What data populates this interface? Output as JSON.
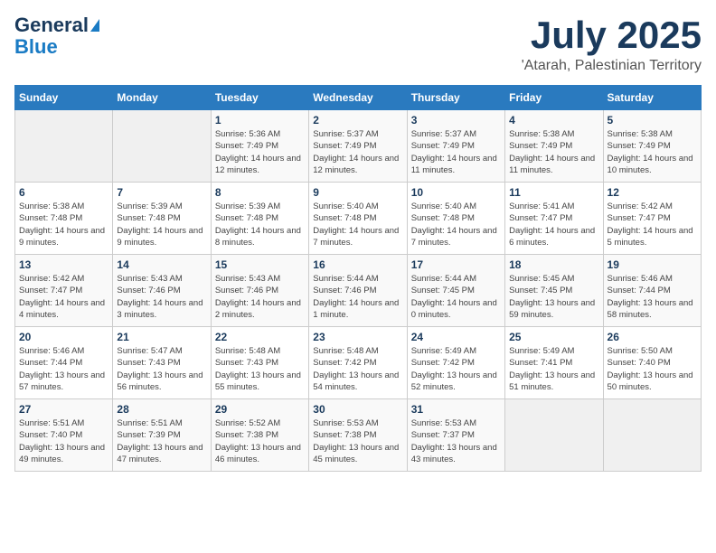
{
  "logo": {
    "line1": "General",
    "line2": "Blue"
  },
  "title": "July 2025",
  "location": "'Atarah, Palestinian Territory",
  "weekdays": [
    "Sunday",
    "Monday",
    "Tuesday",
    "Wednesday",
    "Thursday",
    "Friday",
    "Saturday"
  ],
  "weeks": [
    [
      {
        "day": "",
        "sunrise": "",
        "sunset": "",
        "daylight": ""
      },
      {
        "day": "",
        "sunrise": "",
        "sunset": "",
        "daylight": ""
      },
      {
        "day": "1",
        "sunrise": "Sunrise: 5:36 AM",
        "sunset": "Sunset: 7:49 PM",
        "daylight": "Daylight: 14 hours and 12 minutes."
      },
      {
        "day": "2",
        "sunrise": "Sunrise: 5:37 AM",
        "sunset": "Sunset: 7:49 PM",
        "daylight": "Daylight: 14 hours and 12 minutes."
      },
      {
        "day": "3",
        "sunrise": "Sunrise: 5:37 AM",
        "sunset": "Sunset: 7:49 PM",
        "daylight": "Daylight: 14 hours and 11 minutes."
      },
      {
        "day": "4",
        "sunrise": "Sunrise: 5:38 AM",
        "sunset": "Sunset: 7:49 PM",
        "daylight": "Daylight: 14 hours and 11 minutes."
      },
      {
        "day": "5",
        "sunrise": "Sunrise: 5:38 AM",
        "sunset": "Sunset: 7:49 PM",
        "daylight": "Daylight: 14 hours and 10 minutes."
      }
    ],
    [
      {
        "day": "6",
        "sunrise": "Sunrise: 5:38 AM",
        "sunset": "Sunset: 7:48 PM",
        "daylight": "Daylight: 14 hours and 9 minutes."
      },
      {
        "day": "7",
        "sunrise": "Sunrise: 5:39 AM",
        "sunset": "Sunset: 7:48 PM",
        "daylight": "Daylight: 14 hours and 9 minutes."
      },
      {
        "day": "8",
        "sunrise": "Sunrise: 5:39 AM",
        "sunset": "Sunset: 7:48 PM",
        "daylight": "Daylight: 14 hours and 8 minutes."
      },
      {
        "day": "9",
        "sunrise": "Sunrise: 5:40 AM",
        "sunset": "Sunset: 7:48 PM",
        "daylight": "Daylight: 14 hours and 7 minutes."
      },
      {
        "day": "10",
        "sunrise": "Sunrise: 5:40 AM",
        "sunset": "Sunset: 7:48 PM",
        "daylight": "Daylight: 14 hours and 7 minutes."
      },
      {
        "day": "11",
        "sunrise": "Sunrise: 5:41 AM",
        "sunset": "Sunset: 7:47 PM",
        "daylight": "Daylight: 14 hours and 6 minutes."
      },
      {
        "day": "12",
        "sunrise": "Sunrise: 5:42 AM",
        "sunset": "Sunset: 7:47 PM",
        "daylight": "Daylight: 14 hours and 5 minutes."
      }
    ],
    [
      {
        "day": "13",
        "sunrise": "Sunrise: 5:42 AM",
        "sunset": "Sunset: 7:47 PM",
        "daylight": "Daylight: 14 hours and 4 minutes."
      },
      {
        "day": "14",
        "sunrise": "Sunrise: 5:43 AM",
        "sunset": "Sunset: 7:46 PM",
        "daylight": "Daylight: 14 hours and 3 minutes."
      },
      {
        "day": "15",
        "sunrise": "Sunrise: 5:43 AM",
        "sunset": "Sunset: 7:46 PM",
        "daylight": "Daylight: 14 hours and 2 minutes."
      },
      {
        "day": "16",
        "sunrise": "Sunrise: 5:44 AM",
        "sunset": "Sunset: 7:46 PM",
        "daylight": "Daylight: 14 hours and 1 minute."
      },
      {
        "day": "17",
        "sunrise": "Sunrise: 5:44 AM",
        "sunset": "Sunset: 7:45 PM",
        "daylight": "Daylight: 14 hours and 0 minutes."
      },
      {
        "day": "18",
        "sunrise": "Sunrise: 5:45 AM",
        "sunset": "Sunset: 7:45 PM",
        "daylight": "Daylight: 13 hours and 59 minutes."
      },
      {
        "day": "19",
        "sunrise": "Sunrise: 5:46 AM",
        "sunset": "Sunset: 7:44 PM",
        "daylight": "Daylight: 13 hours and 58 minutes."
      }
    ],
    [
      {
        "day": "20",
        "sunrise": "Sunrise: 5:46 AM",
        "sunset": "Sunset: 7:44 PM",
        "daylight": "Daylight: 13 hours and 57 minutes."
      },
      {
        "day": "21",
        "sunrise": "Sunrise: 5:47 AM",
        "sunset": "Sunset: 7:43 PM",
        "daylight": "Daylight: 13 hours and 56 minutes."
      },
      {
        "day": "22",
        "sunrise": "Sunrise: 5:48 AM",
        "sunset": "Sunset: 7:43 PM",
        "daylight": "Daylight: 13 hours and 55 minutes."
      },
      {
        "day": "23",
        "sunrise": "Sunrise: 5:48 AM",
        "sunset": "Sunset: 7:42 PM",
        "daylight": "Daylight: 13 hours and 54 minutes."
      },
      {
        "day": "24",
        "sunrise": "Sunrise: 5:49 AM",
        "sunset": "Sunset: 7:42 PM",
        "daylight": "Daylight: 13 hours and 52 minutes."
      },
      {
        "day": "25",
        "sunrise": "Sunrise: 5:49 AM",
        "sunset": "Sunset: 7:41 PM",
        "daylight": "Daylight: 13 hours and 51 minutes."
      },
      {
        "day": "26",
        "sunrise": "Sunrise: 5:50 AM",
        "sunset": "Sunset: 7:40 PM",
        "daylight": "Daylight: 13 hours and 50 minutes."
      }
    ],
    [
      {
        "day": "27",
        "sunrise": "Sunrise: 5:51 AM",
        "sunset": "Sunset: 7:40 PM",
        "daylight": "Daylight: 13 hours and 49 minutes."
      },
      {
        "day": "28",
        "sunrise": "Sunrise: 5:51 AM",
        "sunset": "Sunset: 7:39 PM",
        "daylight": "Daylight: 13 hours and 47 minutes."
      },
      {
        "day": "29",
        "sunrise": "Sunrise: 5:52 AM",
        "sunset": "Sunset: 7:38 PM",
        "daylight": "Daylight: 13 hours and 46 minutes."
      },
      {
        "day": "30",
        "sunrise": "Sunrise: 5:53 AM",
        "sunset": "Sunset: 7:38 PM",
        "daylight": "Daylight: 13 hours and 45 minutes."
      },
      {
        "day": "31",
        "sunrise": "Sunrise: 5:53 AM",
        "sunset": "Sunset: 7:37 PM",
        "daylight": "Daylight: 13 hours and 43 minutes."
      },
      {
        "day": "",
        "sunrise": "",
        "sunset": "",
        "daylight": ""
      },
      {
        "day": "",
        "sunrise": "",
        "sunset": "",
        "daylight": ""
      }
    ]
  ]
}
